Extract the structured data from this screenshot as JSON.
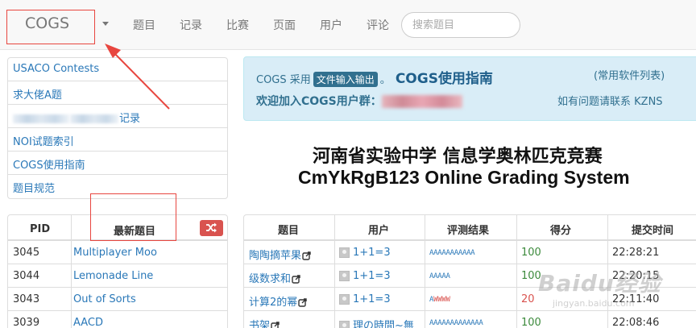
{
  "navbar": {
    "brand": "COGS",
    "items": [
      "题目",
      "记录",
      "比赛",
      "页面",
      "用户",
      "评论"
    ],
    "search_placeholder": "搜索题目"
  },
  "links": {
    "items": [
      "USACO Contests",
      "求大佬A题",
      "记录",
      "NOI试题索引",
      "COGS使用指南",
      "题目规范"
    ]
  },
  "latest": {
    "col_pid": "PID",
    "col_title": "最新题目",
    "rows": [
      {
        "pid": "3045",
        "title": "Multiplayer Moo"
      },
      {
        "pid": "3044",
        "title": "Lemonade Line"
      },
      {
        "pid": "3043",
        "title": "Out of Sorts"
      },
      {
        "pid": "3039",
        "title": "AACD"
      }
    ]
  },
  "notice": {
    "line1_prefix": "COGS 采用",
    "line1_badge": "文件输入输出",
    "line1_sep": "。",
    "guide_link": "COGS使用指南",
    "software_link": "(常用软件列表)",
    "line2": "欢迎加入COGS用户群：",
    "bug_link": "如有问题请联系 KZNS"
  },
  "heading": {
    "cn": "河南省实验中学 信息学奥林匹克竞赛",
    "en": "CmYkRgB123 Online Grading System"
  },
  "records": {
    "headers": [
      "题目",
      "用户",
      "评测结果",
      "得分",
      "提交时间"
    ],
    "rows": [
      {
        "problem": "陶陶摘苹果",
        "user": "1+1=3",
        "result": "AAAAAAAAAAA",
        "score": "100",
        "time": "22:28:21"
      },
      {
        "problem": "级数求和",
        "user": "1+1=3",
        "result": "AAAAA",
        "score": "100",
        "time": "22:20:15"
      },
      {
        "problem": "计算2的幂",
        "user": "1+1=3",
        "result": "AWWWW",
        "score": "20",
        "time": "22:11:40"
      },
      {
        "problem": "书架",
        "user": "理の時間~無",
        "result": "AAAAAAAAAAAAA",
        "score": "100",
        "time": "22:08:46"
      }
    ]
  },
  "watermark": {
    "brand": "Baidu经验",
    "url": "jingyan.baidu.com"
  },
  "colors": {
    "link": "#2a78b8",
    "accepted": "#2a78b8",
    "wrong": "#d9534f",
    "score_full": "#3c8a3c",
    "score_low": "#d9534f",
    "notice_bg": "#d9edf7",
    "annotation": "#e8463f"
  }
}
